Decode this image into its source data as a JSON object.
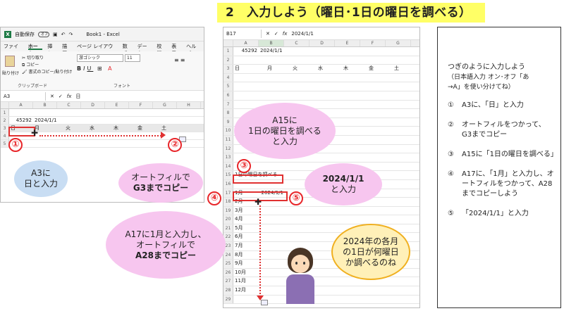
{
  "title": "2　入力しよう（曜日･1日の曜日を調べる）",
  "left_excel": {
    "titlebar": {
      "autosave": "自動保存",
      "toggle": "オフ",
      "book": "Book1 - Excel"
    },
    "menu": [
      "ファイル",
      "ホーム",
      "挿入",
      "描画",
      "ページ レイアウト",
      "数式",
      "データ",
      "校閲",
      "表示",
      "ヘルプ"
    ],
    "ribbon": {
      "paste": "貼り付け",
      "cut": "切り取り",
      "copy": "コピー",
      "format_painter": "書式のコピー/貼り付け",
      "clipboard": "クリップボード",
      "font_name": "游ゴシック",
      "font_size": "11",
      "font_group": "フォント"
    },
    "namebox": "A3",
    "formula": "日",
    "columns": [
      "A",
      "B",
      "C",
      "D",
      "E",
      "F",
      "G",
      "H"
    ],
    "rows": [
      {
        "n": "1",
        "cells": [
          "",
          "",
          "",
          "",
          "",
          "",
          "",
          ""
        ]
      },
      {
        "n": "2",
        "cells": [
          "45292",
          "2024/1/1",
          "",
          "",
          "",
          "",
          "",
          ""
        ]
      },
      {
        "n": "3",
        "cells": [
          "日",
          "月",
          "火",
          "水",
          "木",
          "金",
          "土",
          ""
        ]
      },
      {
        "n": "4",
        "cells": [
          "",
          "",
          "",
          "",
          "",
          "",
          "",
          ""
        ]
      },
      {
        "n": "5",
        "cells": [
          "",
          "",
          "",
          "",
          "",
          "",
          "",
          ""
        ]
      }
    ]
  },
  "right_excel": {
    "namebox": "B17",
    "formula": "2024/1/1",
    "columns": [
      "A",
      "B",
      "C",
      "D",
      "E",
      "F",
      "G"
    ],
    "row1": [
      "45292",
      "2024/1/1"
    ],
    "row3": [
      "日",
      "月",
      "火",
      "水",
      "木",
      "金",
      "土"
    ],
    "row15": "1日の曜日を調べる",
    "row17": [
      "1月",
      "2024/1/1"
    ],
    "months": [
      "2月",
      "3月",
      "4月",
      "5月",
      "6月",
      "7月",
      "8月",
      "9月",
      "10月",
      "11月",
      "12月"
    ],
    "row_numbers": [
      "1",
      "2",
      "3",
      "4",
      "5",
      "6",
      "7",
      "8",
      "9",
      "10",
      "11",
      "12",
      "13",
      "14",
      "15",
      "16",
      "17",
      "18",
      "19",
      "20",
      "21",
      "22",
      "23",
      "24",
      "25",
      "26",
      "27",
      "28",
      "29"
    ]
  },
  "callouts": {
    "c1": "①",
    "c2": "②",
    "c3": "③",
    "c4": "④",
    "c5": "⑤",
    "a3_line1": "A3に",
    "a3_line2": "日と入力",
    "autofill_line1": "オートフィルで",
    "autofill_line2": "G3までコピー",
    "a15_line1": "A15に",
    "a15_line2": "1日の曜日を調べる",
    "a15_line3": "と入力",
    "date_line1": "2024/1/1",
    "date_line2": "と入力",
    "a17_line1": "A17に1月と入力し、",
    "a17_line2": "オートフィルで",
    "a17_line3": "A28までコピー",
    "thought_line1": "2024年の各月",
    "thought_line2": "の1日が何曜日",
    "thought_line3": "か調べるのね"
  },
  "instructions": {
    "heading1": "つぎのように入力しよう",
    "heading2": "（日本語入力 オン･オフ「あ",
    "heading3": "→A」を使い分けてね）",
    "steps": [
      {
        "n": "①",
        "text": "A3に、「日」と入力"
      },
      {
        "n": "②",
        "text": "オートフィルをつかって、G3までコピー"
      },
      {
        "n": "③",
        "text": "A15に「1日の曜日を調べる」"
      },
      {
        "n": "④",
        "text": "A17に、「1月」と入力し、オートフィルをつかって、A28までコピーしよう"
      },
      {
        "n": "⑤",
        "text": "「2024/1/1」と入力"
      }
    ]
  },
  "colors": {
    "accent_red": "#e8262a",
    "title_bg": "#ffff66",
    "excel_green": "#1d7a45"
  }
}
